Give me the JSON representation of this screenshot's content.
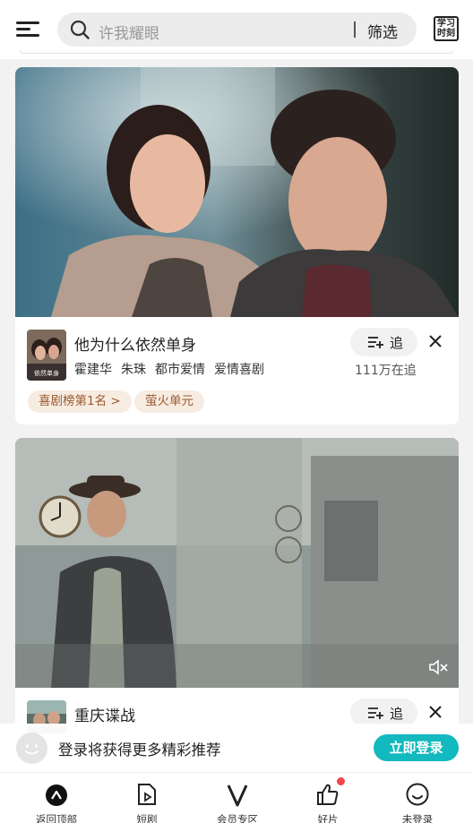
{
  "header": {
    "search_placeholder": "许我耀眼",
    "filter_label": "筛选",
    "study_icon_text": "学习时刻"
  },
  "cards": [
    {
      "title": "他为什么依然单身",
      "tags": [
        "霍建华",
        "朱珠",
        "都市爱情",
        "爱情喜剧"
      ],
      "follow_label": "追",
      "follow_count": "111万在追",
      "pills": [
        "喜剧榜第1名 >",
        "萤火单元"
      ],
      "thumb_text": "依然单身"
    },
    {
      "title": "重庆谍战",
      "follow_label": "追"
    }
  ],
  "login_bar": {
    "text": "登录将获得更多精彩推荐",
    "button": "立即登录"
  },
  "bottom_nav": [
    {
      "label": "返回顶部",
      "icon": "back-to-top-icon"
    },
    {
      "label": "短剧",
      "icon": "short-drama-icon"
    },
    {
      "label": "会员专区",
      "icon": "vip-icon"
    },
    {
      "label": "好片",
      "icon": "thumbs-up-icon"
    },
    {
      "label": "未登录",
      "icon": "smiley-icon"
    }
  ],
  "colors": {
    "accent": "#12b9be",
    "pill_bg": "#f7ece2",
    "pill_text": "#9a5a2e",
    "badge": "#f0474c"
  }
}
